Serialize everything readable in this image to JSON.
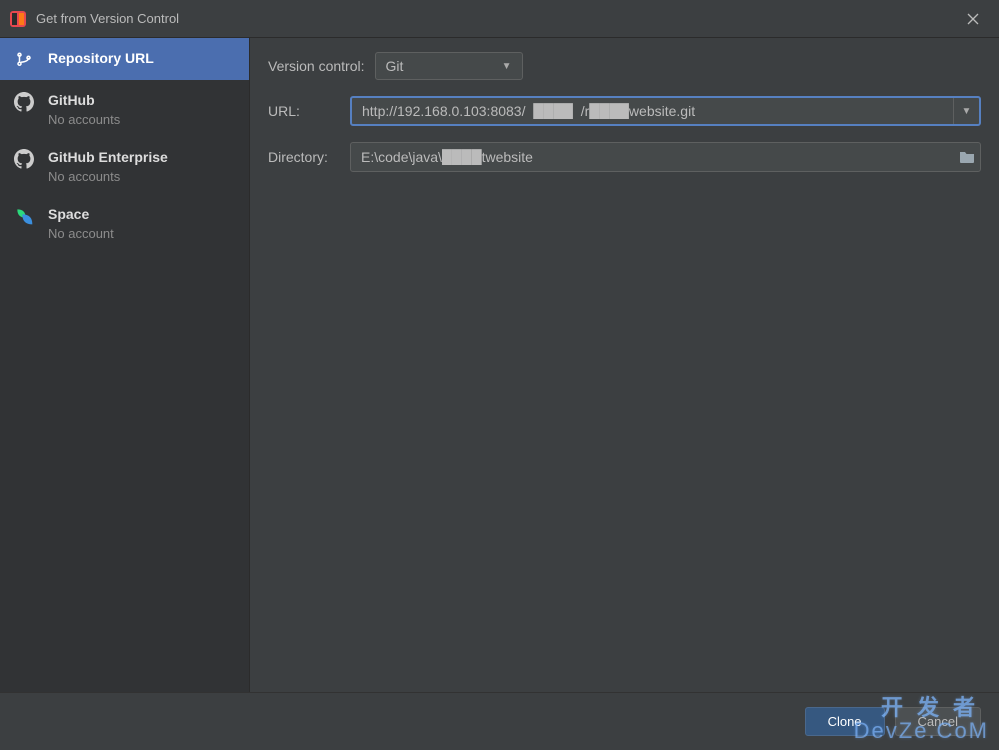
{
  "titlebar": {
    "title": "Get from Version Control"
  },
  "sidebar": {
    "items": [
      {
        "label": "Repository URL",
        "sub": ""
      },
      {
        "label": "GitHub",
        "sub": "No accounts"
      },
      {
        "label": "GitHub Enterprise",
        "sub": "No accounts"
      },
      {
        "label": "Space",
        "sub": "No account"
      }
    ]
  },
  "form": {
    "vc_label": "Version control:",
    "vc_value": "Git",
    "url_label": "URL:",
    "url_value": "http://192.168.0.103:8083/  ████  /r████website.git",
    "dir_label": "Directory:",
    "dir_value": "E:\\code\\java\\████twebsite"
  },
  "footer": {
    "clone": "Clone",
    "cancel": "Cancel"
  },
  "watermark": {
    "line1": "开发者",
    "line2": "DevZe.CoM"
  }
}
